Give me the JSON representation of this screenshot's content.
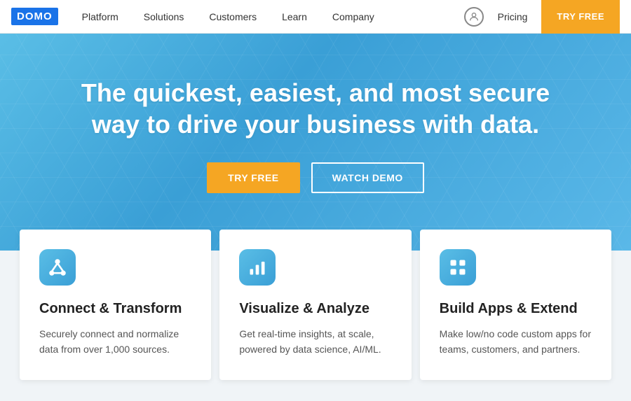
{
  "logo": {
    "text": "DOMO"
  },
  "navbar": {
    "links": [
      {
        "label": "Platform",
        "id": "platform"
      },
      {
        "label": "Solutions",
        "id": "solutions"
      },
      {
        "label": "Customers",
        "id": "customers"
      },
      {
        "label": "Learn",
        "id": "learn"
      },
      {
        "label": "Company",
        "id": "company"
      }
    ],
    "pricing_label": "Pricing",
    "try_free_label": "TRY FREE"
  },
  "hero": {
    "title": "The quickest, easiest, and most secure way to drive your business with data.",
    "try_free_label": "TRY FREE",
    "watch_demo_label": "WATCH DEMO"
  },
  "cards": [
    {
      "id": "connect",
      "icon": "connect",
      "title": "Connect & Transform",
      "description": "Securely connect and normalize data from over 1,000 sources."
    },
    {
      "id": "visualize",
      "icon": "chart",
      "title": "Visualize & Analyze",
      "description": "Get real-time insights, at scale, powered by data science, AI/ML."
    },
    {
      "id": "build",
      "icon": "grid",
      "title": "Build Apps & Extend",
      "description": "Make low/no code custom apps for teams, customers, and partners."
    }
  ]
}
